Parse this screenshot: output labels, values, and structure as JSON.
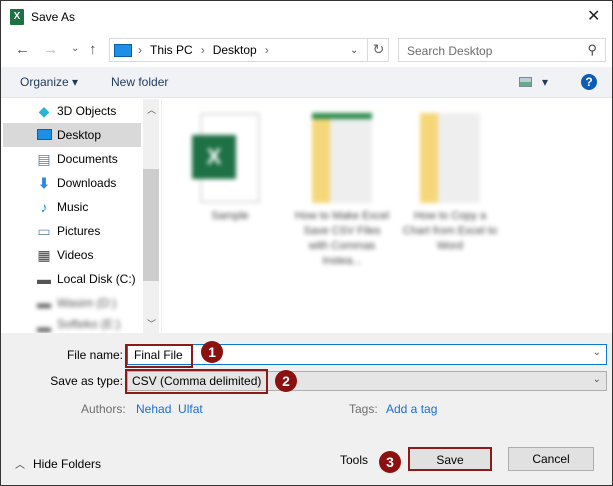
{
  "window": {
    "title": "Save As",
    "close": "✕"
  },
  "nav": {
    "back": "←",
    "forward": "→",
    "recent": "⌄",
    "up": "↑",
    "breadcrumb": [
      "This PC",
      "Desktop"
    ],
    "refresh": "↻",
    "search_placeholder": "Search Desktop"
  },
  "toolbar": {
    "organize": "Organize ▾",
    "new_folder": "New folder",
    "help": "?",
    "view_dropdown": "▾"
  },
  "sidebar": {
    "items": [
      {
        "label": "3D Objects",
        "icon": "cube-icon"
      },
      {
        "label": "Desktop",
        "icon": "desktop-icon",
        "selected": true
      },
      {
        "label": "Documents",
        "icon": "documents-icon"
      },
      {
        "label": "Downloads",
        "icon": "download-icon"
      },
      {
        "label": "Music",
        "icon": "music-icon"
      },
      {
        "label": "Pictures",
        "icon": "pictures-icon"
      },
      {
        "label": "Videos",
        "icon": "videos-icon"
      },
      {
        "label": "Local Disk (C:)",
        "icon": "drive-icon"
      },
      {
        "label": "Wasim (D:)",
        "icon": "drive-icon",
        "blurred": true
      },
      {
        "label": "Softeko (E:)",
        "icon": "drive-icon",
        "blurred": true
      }
    ]
  },
  "files": [
    {
      "name": "Sample",
      "type": "excel"
    },
    {
      "name": "How to Make Excel Save CSV Files with Commas Instea...",
      "type": "folder"
    },
    {
      "name": "How to Copy a Chart from Excel to Word",
      "type": "folder"
    }
  ],
  "form": {
    "file_name_label": "File name:",
    "file_name_value": "Final File",
    "save_type_label": "Save as type:",
    "save_type_value": "CSV (Comma delimited)",
    "authors_label": "Authors:",
    "authors_value": "Nehad  Ulfat",
    "tags_label": "Tags:",
    "tags_value": "Add a tag"
  },
  "footer": {
    "hide_folders": "Hide Folders",
    "tools": "Tools",
    "save": "Save",
    "cancel": "Cancel"
  },
  "annotations": [
    "1",
    "2",
    "3"
  ],
  "colors": {
    "highlight": "#8b1a1a",
    "badge": "#8b1010",
    "link": "#1a6fd1"
  }
}
